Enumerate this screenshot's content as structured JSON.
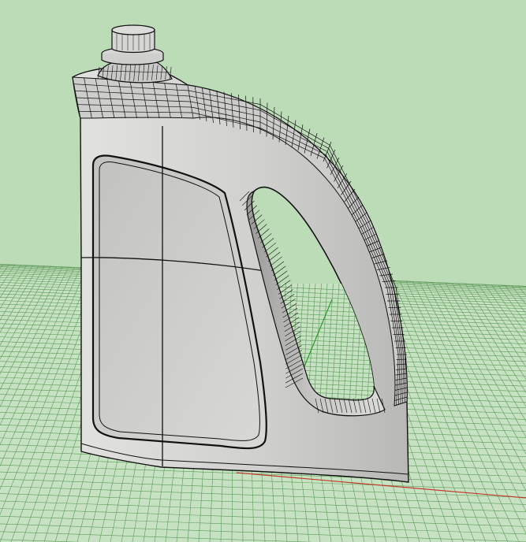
{
  "viewport": {
    "background_color": "#bcdcb8",
    "grid": {
      "visible": true,
      "fill_color": "#c6e2c2",
      "line_color": "#5f9a5a",
      "x_axis_color": "#c23a2a",
      "y_axis_color": "#2a9a2a"
    },
    "model": {
      "object": "bottle",
      "display_mode": "shaded-wireframe",
      "surface_color": "#d3d3d1",
      "wire_color": "#111111"
    }
  }
}
